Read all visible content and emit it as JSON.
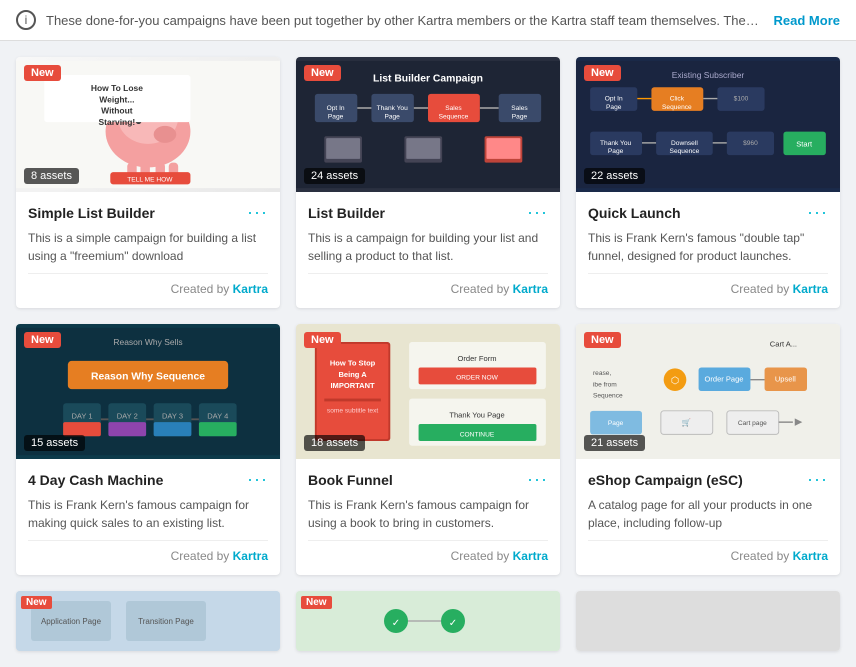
{
  "banner": {
    "icon": "i",
    "text": "These done-for-you campaigns have been put together by other Kartra members or the Kartra staff team themselves. They w...",
    "read_more": "Read More"
  },
  "cards": [
    {
      "id": "simple-list-builder",
      "badge_new": "New",
      "assets": "8 assets",
      "thumb_type": "piggy",
      "title": "Simple List Builder",
      "description": "This is a simple campaign for building a list using a \"freemium\" download",
      "created_by": "Created by",
      "author": "Kartra"
    },
    {
      "id": "list-builder",
      "badge_new": "New",
      "assets": "24 assets",
      "thumb_type": "dark",
      "title": "List Builder",
      "description": "This is a campaign for building your list and selling a product to that list.",
      "created_by": "Created by",
      "author": "Kartra"
    },
    {
      "id": "quick-launch",
      "badge_new": "New",
      "assets": "22 assets",
      "thumb_type": "blue",
      "title": "Quick Launch",
      "description": "This is Frank Kern's famous \"double tap\" funnel, designed for product launches.",
      "created_by": "Created by",
      "author": "Kartra"
    },
    {
      "id": "4-day-cash-machine",
      "badge_new": "New",
      "assets": "15 assets",
      "thumb_type": "teal",
      "title": "4 Day Cash Machine",
      "description": "This is Frank Kern's famous campaign for making quick sales to an existing list.",
      "created_by": "Created by",
      "author": "Kartra"
    },
    {
      "id": "book-funnel",
      "badge_new": "New",
      "assets": "18 assets",
      "thumb_type": "light",
      "title": "Book Funnel",
      "description": "This is Frank Kern's famous campaign for using a book to bring in customers.",
      "created_by": "Created by",
      "author": "Kartra"
    },
    {
      "id": "eshop-campaign",
      "badge_new": "New",
      "assets": "21 assets",
      "thumb_type": "white",
      "title": "eShop Campaign (eSC)",
      "description": "A catalog page for all your products in one place, including follow-up",
      "created_by": "Created by",
      "author": "Kartra"
    }
  ],
  "bottom_cards": [
    {
      "id": "bottom-1",
      "badge_new": "New",
      "thumb_type": "light-blue"
    },
    {
      "id": "bottom-2",
      "badge_new": "New",
      "thumb_type": "green"
    },
    {
      "id": "bottom-3",
      "visible": false
    }
  ]
}
